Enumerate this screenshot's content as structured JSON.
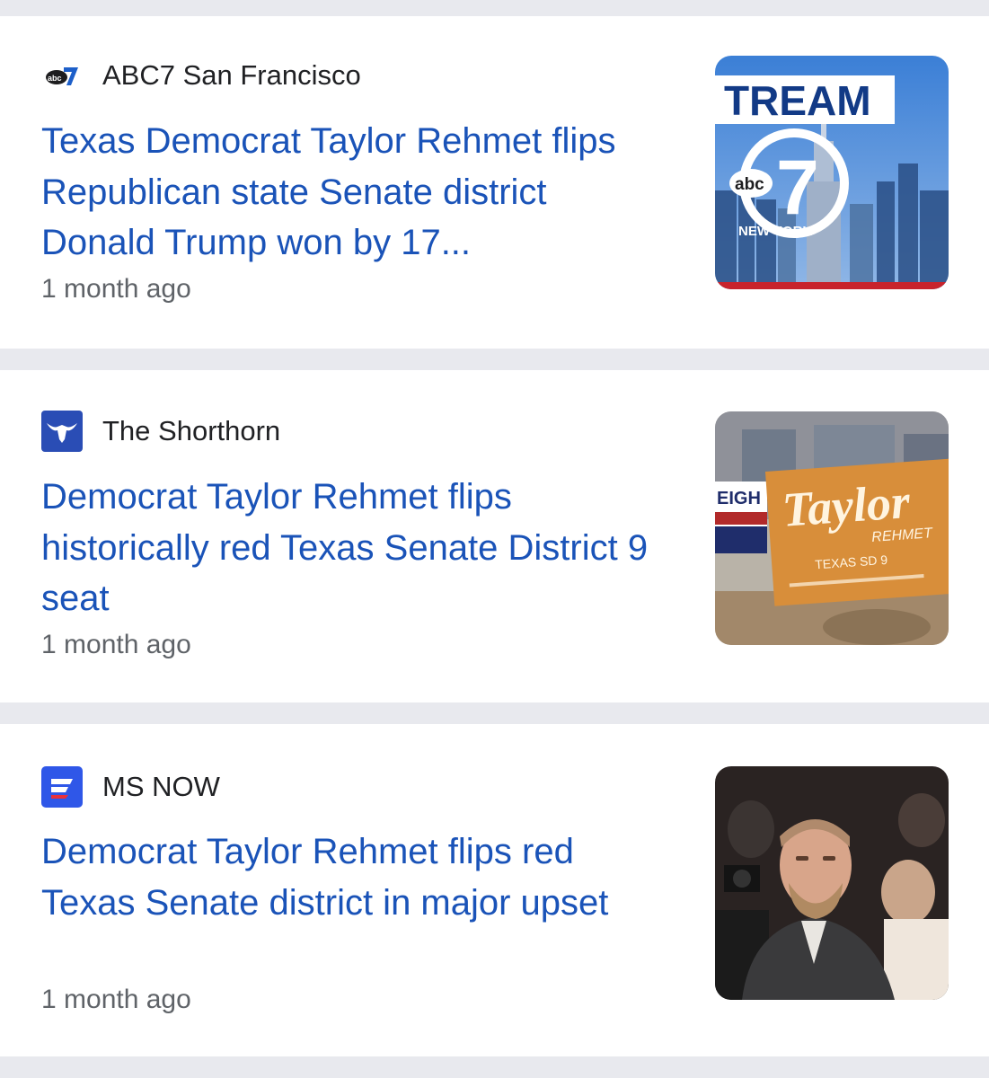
{
  "feed": {
    "articles": [
      {
        "source": "ABC7 San Francisco",
        "source_icon": "abc7-logo-icon",
        "headline": "Texas Democrat Taylor Rehmet flips Republican state Senate district Donald Trump won by 17...",
        "time": "1 month ago",
        "thumbnail": {
          "kind": "abc7-new-york-broadcast-graphic",
          "banner_text": "TREAM",
          "logo_text": "abc",
          "logo_number": "7",
          "caption": "NEW YORK"
        }
      },
      {
        "source": "The Shorthorn",
        "source_icon": "longhorn-logo-icon",
        "headline": "Democrat Taylor Rehmet flips historically red Texas Senate District 9 seat",
        "time": "1 month ago",
        "thumbnail": {
          "kind": "campaign-yard-sign-photo",
          "sign_name": "Taylor",
          "sign_sub": "REHMET",
          "sign_line": "TEXAS SD 9",
          "left_sign_text": "EIGH"
        }
      },
      {
        "source": "MS NOW",
        "source_icon": "ms-now-logo-icon",
        "headline": "Democrat Taylor Rehmet flips red Texas Senate district in major upset",
        "time": "1 month ago",
        "thumbnail": {
          "kind": "crowd-portrait-photo"
        }
      }
    ]
  },
  "colors": {
    "headline": "#1a53b8",
    "source": "#202124",
    "timestamp": "#5f6368",
    "separator": "#e8e9ee",
    "card": "#ffffff",
    "shorthorn_brand": "#2a4db5",
    "msnow_brand": "#2f57e8"
  }
}
